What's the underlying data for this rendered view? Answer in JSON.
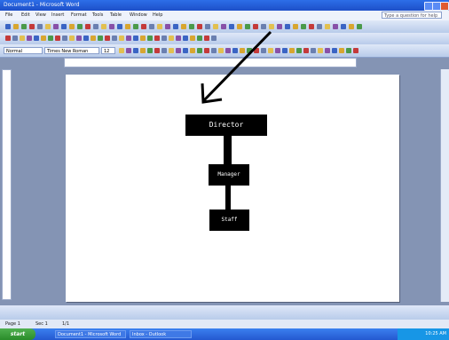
{
  "window": {
    "title": "Document1 - Microsoft Word"
  },
  "menu": [
    "File",
    "Edit",
    "View",
    "Insert",
    "Format",
    "Tools",
    "Table",
    "Window",
    "Help"
  ],
  "help_box": {
    "placeholder": "Type a question for help"
  },
  "toolbar": {
    "style_box": "Normal",
    "font_box": "Times New Roman",
    "size_box": "12"
  },
  "org_chart": {
    "top_label": "Director",
    "mid_label": "Manager",
    "bottom_label": "Staff"
  },
  "statusbar": {
    "page": "Page 1",
    "sec": "Sec 1",
    "pos": "1/1"
  },
  "taskbar": {
    "start": "start",
    "clock": "10:25 AM",
    "tasks": [
      "Document1 - Microsoft Word",
      "Inbox - Outlook"
    ]
  },
  "colors": {
    "titlebar": "#2d6ee8",
    "taskbar": "#2458d0",
    "start": "#2a8c2a"
  }
}
